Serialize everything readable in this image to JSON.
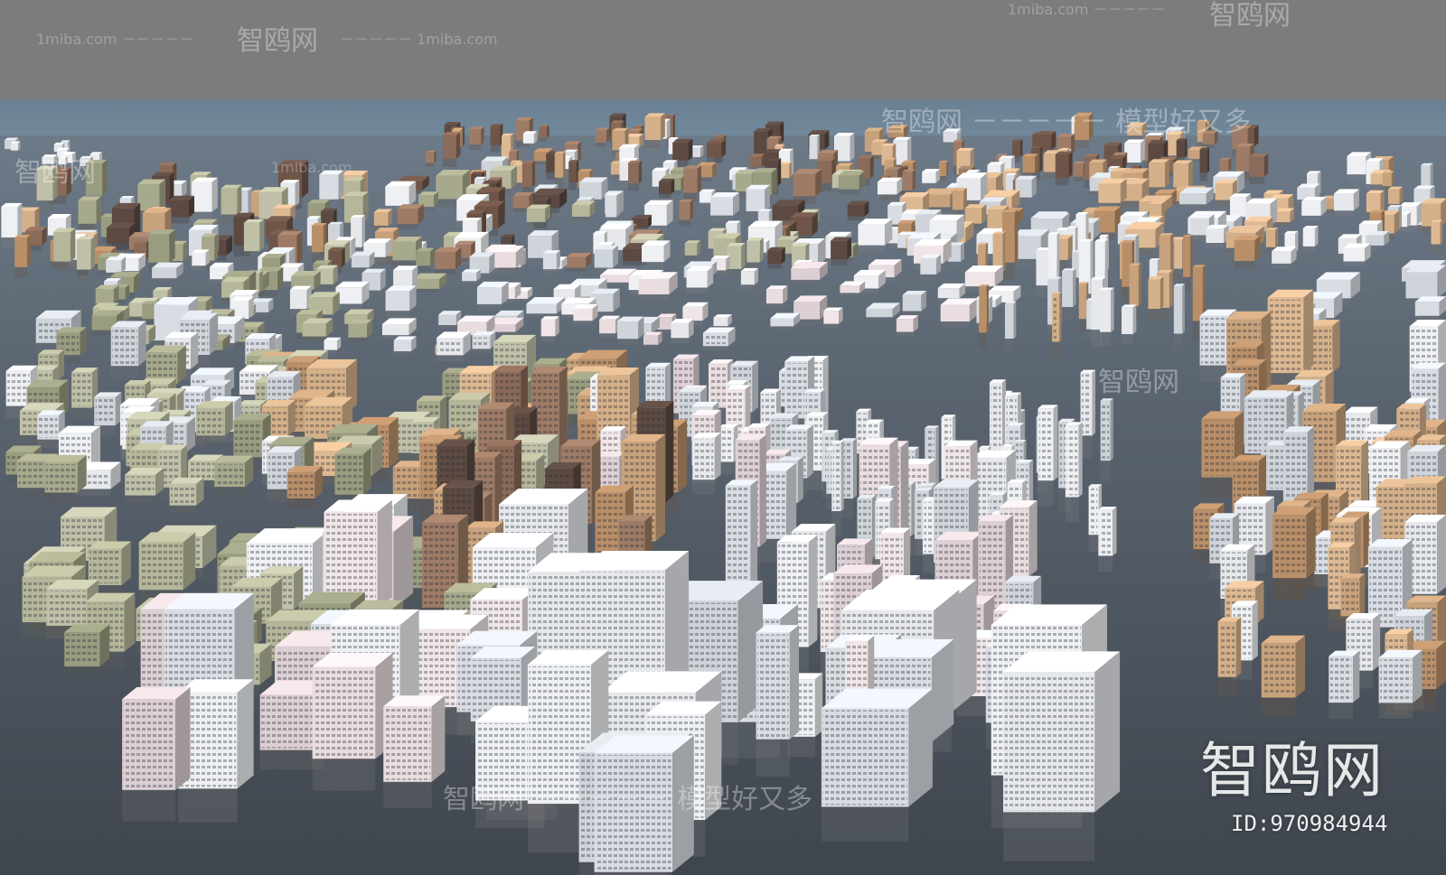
{
  "watermarks": {
    "site": "1miba.com",
    "dashes": "－－－－－",
    "brand": "智鸥网",
    "slogan": "模型好又多",
    "brand_large": "智鸥网",
    "id_label": "ID:970984944"
  },
  "colors": {
    "top_band": "#7b7c7e",
    "sky": "#6f8598",
    "water": "#525a65",
    "building_white": "#e6e8ec",
    "building_tan": "#c8a27c",
    "building_brown": "#8a6a58",
    "building_green": "#a7a98c"
  }
}
